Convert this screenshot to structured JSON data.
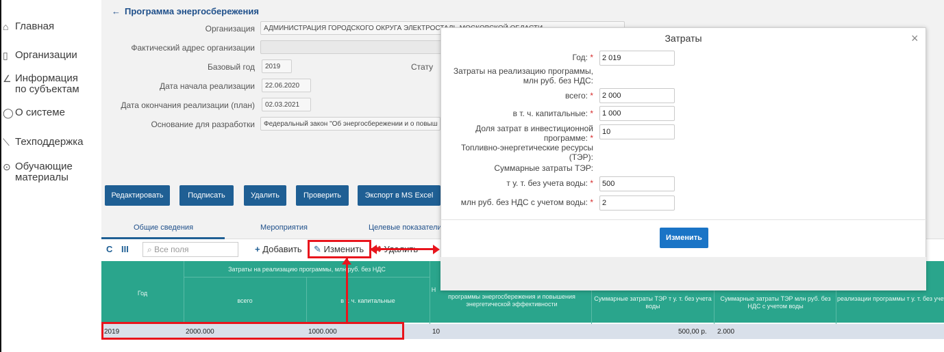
{
  "sidebar": {
    "items": [
      {
        "label": "Главная",
        "icon": "home-icon"
      },
      {
        "label": "Организации",
        "icon": "building-icon"
      },
      {
        "label": "Информация\nпо субъектам",
        "icon": "info-icon"
      },
      {
        "label": "О системе",
        "icon": "about-icon"
      },
      {
        "label": "Техподдержка",
        "icon": "support-icon"
      },
      {
        "label": "Обучающие\nматериалы",
        "icon": "learning-icon"
      }
    ]
  },
  "form": {
    "back_label": "Программа энергосбережения",
    "org_label": "Организация",
    "org_value": "АДМИНИСТРАЦИЯ ГОРОДСКОГО ОКРУГА ЭЛЕКТРОСТАЛЬ МОСКОВСКОЙ ОБЛАСТИ",
    "address_label": "Фактический адрес организации",
    "address_value": "",
    "base_year_label": "Базовый год",
    "base_year_value": "2019",
    "status_label": "Стату",
    "start_label": "Дата начала реализации",
    "start_value": "22.06.2020",
    "end_label": "Дата окончания реализации (план)",
    "end_value": "02.03.2021",
    "basis_label": "Основание для разработки",
    "basis_value": "Федеральный закон \"Об энергосбережении и о повыш"
  },
  "buttons": {
    "edit": "Редактировать",
    "sign": "Подписать",
    "delete": "Удалить",
    "check": "Проверить",
    "export": "Экспорт в MS Excel"
  },
  "tabs": [
    "Общие сведения",
    "Мероприятия",
    "Целевые показатели"
  ],
  "toolbar": {
    "search_placeholder": "Все поля",
    "add": "Добавить",
    "edit": "Изменить",
    "delete": "Удалить"
  },
  "table": {
    "group_header": "Затраты на реализацию программы, млн руб. без НДС",
    "col_year": "Год",
    "col_total": "всего",
    "col_capital": "в т. ч. капитальные",
    "col_share": "программы энергосбережения и повышения энергетической эффективности",
    "col_share_prefix": "Н",
    "col_tut": "Суммарные затраты ТЭР т у. т. без учета воды",
    "col_rub": "Суммарные затраты ТЭР млн руб. без НДС с учетом воды",
    "col_last": "реализации программы т у. т. без учета воды",
    "row": {
      "year": "2019",
      "total": "2000.000",
      "capital": "1000.000",
      "share": "10",
      "tut": "500,00 р.",
      "rub": "2.000"
    }
  },
  "modal": {
    "title": "Затраты",
    "close": "×",
    "year_label": "Год:",
    "year_value": "2 019",
    "costs_heading": "Затраты на реализацию программы, млн руб. без НДС:",
    "total_label": "всего:",
    "total_value": "2 000",
    "capital_label": "в т. ч. капитальные:",
    "capital_value": "1 000",
    "share_label": "Доля затрат в инвестиционной программе:",
    "share_value": "10",
    "ter_heading": "Топливно-энергетические ресурсы (ТЭР):",
    "ter_sum_heading": "Суммарные затраты ТЭР:",
    "tut_label": "т у. т. без учета воды:",
    "tut_value": "500",
    "rub_label": "млн руб. без НДС с учетом воды:",
    "rub_value": "2",
    "submit": "Изменить"
  },
  "colors": {
    "primary": "#1f5f94",
    "table_header": "#2aa58c",
    "annotation": "#e8141c",
    "modal_button": "#1a74c6"
  }
}
